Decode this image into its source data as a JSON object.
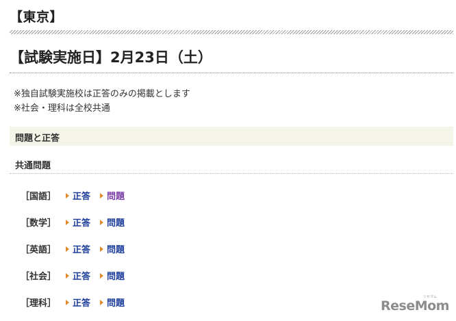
{
  "region_title": "【東京】",
  "exam_date": "【試験実施日】2月23日（土）",
  "notes": [
    "※独自試験実施校は正答のみの掲載とします",
    "※社会・理科は全校共通"
  ],
  "section_label": "問題と正答",
  "common_label": "共通問題",
  "subjects": [
    {
      "name": "［国語］",
      "answer": "正答",
      "question": "問題",
      "question_visited": true
    },
    {
      "name": "［数学］",
      "answer": "正答",
      "question": "問題",
      "question_visited": false
    },
    {
      "name": "［英語］",
      "answer": "正答",
      "question": "問題",
      "question_visited": false
    },
    {
      "name": "［社会］",
      "answer": "正答",
      "question": "問題",
      "question_visited": false
    },
    {
      "name": "［理科］",
      "answer": "正答",
      "question": "問題",
      "question_visited": false
    }
  ],
  "logo": {
    "text": "ReseMom",
    "kana": "リセマム"
  },
  "colors": {
    "link": "#1f3f9c",
    "link_visited": "#7b3fa8",
    "arrow": "#e08a2c",
    "section_band": "#f4f5e8",
    "logo": "#8c8c8c"
  }
}
